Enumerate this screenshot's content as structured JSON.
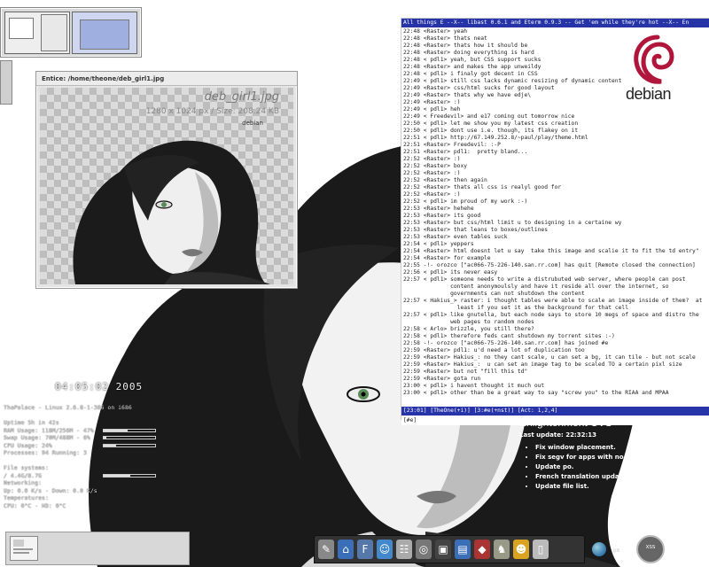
{
  "viewer": {
    "title": "Entice: /home/theone/deb_girl1.jpg",
    "filename": "deb_girl1.jpg",
    "info": "1280 x 1024 px / Size:  208.24 KB",
    "logo_text": "debian"
  },
  "irc": {
    "topic": "All things E  --X--  libast 0.6.1 and Eterm 0.9.3 -- Get 'em while they're hot  --X--  En",
    "lines": [
      "22:48 <Raster> yeah",
      "22:48 <Raster> thats neat",
      "22:48 <Raster> thats how it should be",
      "22:48 <Raster> doing everything is hard",
      "22:48 < pdl1> yeah, but CSS support sucks",
      "22:48 <Raster> and makes the app unweildy",
      "22:48 < pdl1> i finaly got decent in CSS",
      "22:49 < pdl1> still css lacks dynamic resizing of dynamic content",
      "22:49 <Raster> css/html sucks for good layout",
      "22:49 <Raster> thats why we have edje\\",
      "22:49 <Raster> :)",
      "22:49 < pdl1> heh",
      "22:49 < Freedevil> and e17 coming out tomorrow nice",
      "22:50 < pdl1> let me show you my latest css creation",
      "22:50 < pdl1> dont use i.e. though, its flakey on it",
      "22:51 < pdl1> http://67.149.252.8/~paul/play/theme.html",
      "22:51 <Raster> Freedevil: :-P",
      "22:51 <Raster> pdl1:  pretty bland...",
      "22:52 <Raster> :)",
      "22:52 <Raster> boxy",
      "22:52 <Raster> :)",
      "22:52 <Raster> then again",
      "22:52 <Raster> thats all css is realyl good for",
      "22:52 <Raster> :)",
      "22:52 < pdl1> im proud of my work :-)",
      "22:53 <Raster> hehehe",
      "22:53 <Raster> its good",
      "22:53 <Raster> but css/html limit u to designing in a certaine wy",
      "22:53 <Raster> that leans to boxes/outlines",
      "22:53 <Raster> even tables suck",
      "22:54 < pdl1> yeppers",
      "22:54 <Raster> html doesnt let u say  take this image and scalie it to fit the td entry\"",
      "22:54 <Raster> for example",
      "22:55 -!- orozco [\"ac066-75-226-140.san.rr.com] has quit [Remote closed the connection]",
      "22:56 < pdl1> its never easy",
      "22:57 < pdl1> someone needs to write a distrubuted web server, where people can post",
      "              content anonymoulsly and have it reside all over the internet, so",
      "              governments can not shutdown the content",
      "22:57 < Hakius_> raster: i thought tables were able to scale an image inside of them?  at",
      "                least if you set it as the background for that cell",
      "22:57 < pdl1> like gnutella, but each node says to store 10 megs of space and distro the",
      "              web pages to random nodes",
      "22:58 < Arlo> brizzle, you still there?",
      "22:58 < pdl1> therefore feds cant shutdown my torrent sites :-)",
      "22:58 -!- orozco [\"ac066-75-226-140.san.rr.com] has joined #e",
      "22:59 <Raster> pdl1: u'd need a lot of duplication too",
      "22:59 <Raster> Hakius_: no they cant scale, u can set a bg, it can tile - but not scale",
      "22:59 <Raster> Hakius_:  u can set an image tag to be scaled TO a certain pixl size",
      "22:59 <Raster> but not \"fill this td\"",
      "22:59 <Raster> gota run",
      "23:00 < pdl1> i havent thought it much out",
      "23:00 < pdl1> other than be a great way to say \"screw you\" to the RIAA and MPAA"
    ],
    "status": "[23:01] [TheOne(+i)] [3:#e(+nst)] [Act: 1,2,4]",
    "input": "[#e]"
  },
  "debian_logo": "debian",
  "clock": "04:05:02 2005",
  "sysmon": {
    "rows": [
      {
        "label": "ThaPalace - Linux 2.6.8-1-386 on i686",
        "bar": null
      },
      {
        "label": "",
        "bar": null
      },
      {
        "label": "Uptime 5h in 42s",
        "bar": null
      },
      {
        "label": "RAM Usage: 118M/256M - 47%",
        "bar": 0.47
      },
      {
        "label": "Swap Usage: 70M/488M - 6%",
        "bar": 0.06
      },
      {
        "label": "CPU Usage: 24%",
        "bar": 0.24
      },
      {
        "label": "Processes: 94 Running: 3",
        "bar": null
      },
      {
        "label": "",
        "bar": null
      },
      {
        "label": "File systems:",
        "bar": null
      },
      {
        "label": "/ 4.4G/8.7G",
        "bar": 0.51
      },
      {
        "label": "Networking:",
        "bar": null
      },
      {
        "label": "Up: 0.0 K/s - Down: 0.0 K/s",
        "bar": null
      },
      {
        "label": "Temperatures:",
        "bar": null
      },
      {
        "label": "CPU: 0°C - HD: 0°C",
        "bar": null
      }
    ]
  },
  "cvs": {
    "title": "Enlightenment CVS",
    "updated": "Last update: 22:32:13",
    "items": [
      "Fix window placement.",
      "Fix segv for apps with no winclass",
      "Update po.",
      "French translation update (Ludwig Noujarret).",
      "Update file list."
    ]
  },
  "dock": {
    "icons": [
      {
        "name": "pencil-icon",
        "glyph": "✎",
        "color": "#888888"
      },
      {
        "name": "home-folder-icon",
        "glyph": "⌂",
        "color": "#3a6fb8"
      },
      {
        "name": "font-icon",
        "glyph": "F",
        "color": "#5577aa"
      },
      {
        "name": "chat-icon",
        "glyph": "☺",
        "color": "#4488cc"
      },
      {
        "name": "notes-icon",
        "glyph": "☷",
        "color": "#aaaaaa"
      },
      {
        "name": "settings-icon",
        "glyph": "◎",
        "color": "#777777"
      },
      {
        "name": "terminal-icon",
        "glyph": "▣",
        "color": "#444444"
      },
      {
        "name": "folder-icon",
        "glyph": "▤",
        "color": "#3a6fb8"
      },
      {
        "name": "package-icon",
        "glyph": "◆",
        "color": "#a33"
      },
      {
        "name": "game-icon",
        "glyph": "♞",
        "color": "#998"
      },
      {
        "name": "smiley-icon",
        "glyph": "☻",
        "color": "#d9a320"
      },
      {
        "name": "paper-icon",
        "glyph": "▯",
        "color": "#bbbbbb"
      }
    ],
    "clock_time": "11:02",
    "clock_ampm": "pm",
    "stopwatch_label": "XSS"
  }
}
